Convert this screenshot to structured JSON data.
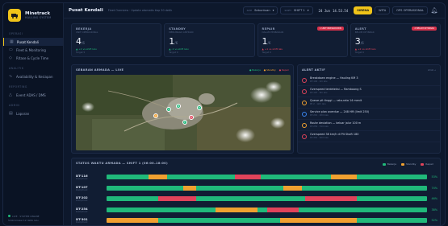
{
  "brand": {
    "name": "Minetrack",
    "subtitle": "HAULING SYSTEM"
  },
  "nav": {
    "section_main": "OPERASI",
    "items": [
      {
        "label": "Pusat Kendali",
        "icon": "grid-icon",
        "active": true
      },
      {
        "label": "Fleet & Monitoring",
        "icon": "truck-icon",
        "active": false
      },
      {
        "label": "Ritase & Cycle Time",
        "icon": "route-icon",
        "active": false
      }
    ],
    "section_analytics": "ANALITIK",
    "analytics_items": [
      {
        "label": "Availability & Kesiapan",
        "icon": "chart-icon"
      }
    ],
    "section_reports": "REPORTING",
    "report_items": [
      {
        "label": "Event ADAS / DMS",
        "icon": "alert-icon"
      }
    ],
    "section_admin": "ADMIN",
    "admin_items": [
      {
        "label": "Laporan",
        "icon": "doc-icon"
      }
    ],
    "footer_line1": "LIVE · SYSTEM ONLINE",
    "footer_line2": "Sinkronisasi 12 detik lalu"
  },
  "topbar": {
    "title": "Pusat Kendali",
    "subtitle": "Fleet Overview · Update otomatis tiap 30 detik",
    "site_label": "SITE",
    "site_value": "Sebuntuan",
    "shift_label": "SHIFT",
    "shift_value": "SHIFT 1",
    "date": "24 Jun",
    "time": "14.53.54",
    "live_label": "SIRENA",
    "wita": "WITA",
    "ops": "OPS OPERASIONAL"
  },
  "kpis": [
    {
      "label": "BEKERJA",
      "sub": "UNIT OPERASIONAL",
      "value": "4",
      "unit": "/6",
      "trend": "▲ +1 vs shift lalu",
      "trend_color": "g",
      "note": "Target 5",
      "tag": ""
    },
    {
      "label": "STANDBY",
      "sub": "MENUNGGU ANTRIAN",
      "value": "1",
      "unit": "/6",
      "trend": "▲ -1 vs shift lalu",
      "trend_color": "g",
      "note": "Target 0",
      "tag": ""
    },
    {
      "label": "REPAIR",
      "sub": "DALAM PERBAIKAN",
      "value": "1",
      "unit": "/6",
      "trend": "▲ +1 vs shift lalu",
      "trend_color": "r",
      "note": "Target 0",
      "tag": "1 UNIT BREAKDOWN"
    },
    {
      "label": "ALERT",
      "sub": "BELUM DITINDAK",
      "value": "3",
      "unit": "/6",
      "trend": "▲ +2 vs shift lalu",
      "trend_color": "r",
      "note": "Target 0",
      "tag": "2 BELUM DITINDAK"
    }
  ],
  "map_panel": {
    "title": "SEBARAN ARMADA — LIVE",
    "legend": [
      "● Bekerja",
      "● Standby",
      "● Repair"
    ],
    "markers": [
      {
        "label": "A",
        "color": "#20b97a"
      },
      {
        "label": "B",
        "color": "#20b97a"
      },
      {
        "label": "C",
        "color": "#f0a030"
      },
      {
        "label": "D",
        "color": "#e0435a"
      },
      {
        "label": "E",
        "color": "#20b97a"
      },
      {
        "label": "F",
        "color": "#20b97a"
      }
    ]
  },
  "alerts_panel": {
    "title": "ALERT AKTIF",
    "link": "Lihat →",
    "items": [
      {
        "text": "Breakdown engine — Hauling KM 3",
        "time": "DT-102 · 2m lalu",
        "color": "#e0435a"
      },
      {
        "text": "Overspeed terdeteksi — Ramboong S",
        "time": "DT-107 · 8m lalu",
        "color": "#e0435a"
      },
      {
        "text": "Queue pit tinggi — rata-rata 14 menit",
        "time": "Pit 2 · 12m lalu",
        "color": "#f0a030"
      },
      {
        "text": "Service plan overdue — 248 HM (limit 250)",
        "time": "DT-201 · 20m lalu",
        "color": "#3a86f0"
      },
      {
        "text": "Route deviation — keluar jalur 100 m",
        "time": "DT-254 · 31m lalu",
        "color": "#f0a030"
      },
      {
        "text": "Overspeed 38 km/h di Pit Shaft 180",
        "time": "DT-301 · 40m lalu",
        "color": "#e0435a"
      }
    ]
  },
  "status_panel": {
    "title": "STATUS WAKTU ARMADA — SHIFT 1 (06:00–18:00)",
    "legend": [
      {
        "label": "Bekerja",
        "color": "#20b97a"
      },
      {
        "label": "Standby",
        "color": "#f0a030"
      },
      {
        "label": "Repair",
        "color": "#e0435a"
      }
    ],
    "rows": [
      {
        "id": "DT-116",
        "type": "Dumptruck",
        "pct": "53%",
        "segments": [
          [
            "g",
            0.13
          ],
          [
            "o",
            0.06
          ],
          [
            "g",
            0.21
          ],
          [
            "r",
            0.08
          ],
          [
            "g",
            0.22
          ],
          [
            "o",
            0.08
          ],
          [
            "g",
            0.22
          ]
        ]
      },
      {
        "id": "DT-107",
        "type": "Dumptruck",
        "pct": "74%",
        "segments": [
          [
            "g",
            0.24
          ],
          [
            "o",
            0.04
          ],
          [
            "g",
            0.27
          ],
          [
            "o",
            0.06
          ],
          [
            "g",
            0.39
          ]
        ]
      },
      {
        "id": "DT-202",
        "type": "Dumptruck",
        "pct": "46%",
        "segments": [
          [
            "g",
            0.16
          ],
          [
            "r",
            0.12
          ],
          [
            "g",
            0.34
          ],
          [
            "r",
            0.16
          ],
          [
            "g",
            0.22
          ]
        ]
      },
      {
        "id": "DT-254",
        "type": "Dumptruck",
        "pct": "38%",
        "segments": [
          [
            "g",
            0.34
          ],
          [
            "o",
            0.13
          ],
          [
            "g",
            0.03
          ],
          [
            "r",
            0.1
          ],
          [
            "g",
            0.4
          ]
        ]
      },
      {
        "id": "DT-301",
        "type": "Dumptruck",
        "pct": "52%",
        "segments": [
          [
            "o",
            0.16
          ],
          [
            "g",
            0.38
          ],
          [
            "o",
            0.24
          ],
          [
            "g",
            0.22
          ]
        ]
      }
    ]
  }
}
